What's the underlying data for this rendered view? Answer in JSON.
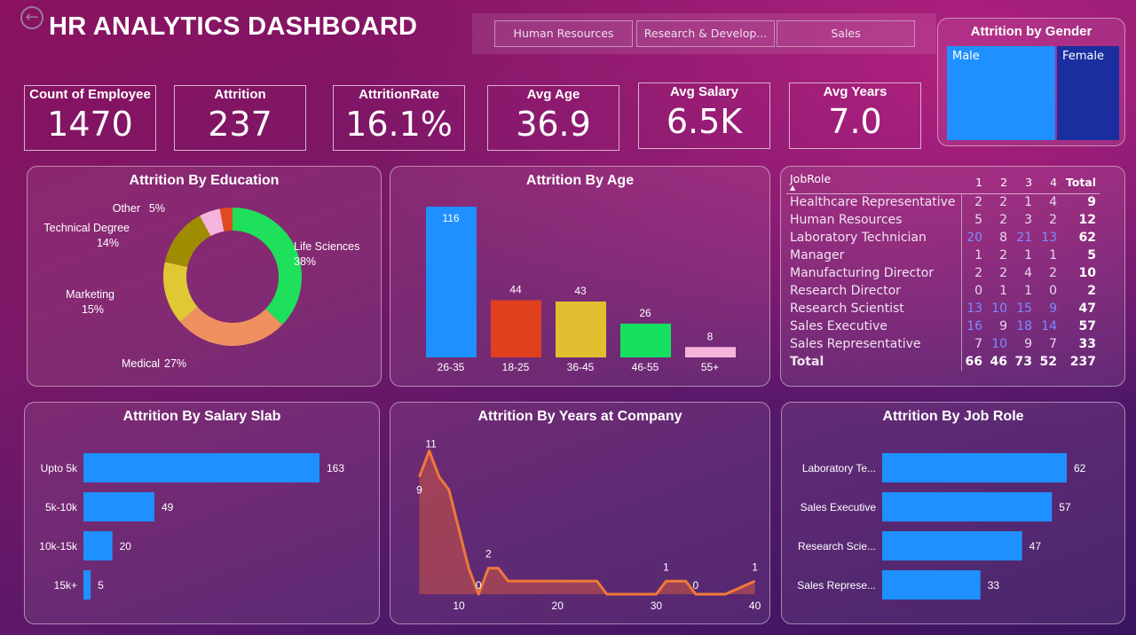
{
  "header": {
    "title": "HR ANALYTICS DASHBOARD",
    "back_icon": "arrow-left-circle-icon"
  },
  "filters": [
    "Human Resources",
    "Research & Develop...",
    "Sales"
  ],
  "gender": {
    "title": "Attrition by Gender",
    "male": "Male",
    "female": "Female",
    "colors": {
      "male": "#1e90ff",
      "female": "#1a2ea0"
    }
  },
  "kpis": [
    {
      "label": "Count of Employee",
      "value": "1470"
    },
    {
      "label": "Attrition",
      "value": "237"
    },
    {
      "label": "AttritionRate",
      "value": "16.1%"
    },
    {
      "label": "Avg Age",
      "value": "36.9"
    },
    {
      "label": "Avg Salary",
      "value": "6.5K"
    },
    {
      "label": "Avg Years",
      "value": "7.0"
    }
  ],
  "table": {
    "headers": [
      "JobRole",
      "1",
      "2",
      "3",
      "4",
      "Total"
    ],
    "rows": [
      [
        "Healthcare Representative",
        "2",
        "2",
        "1",
        "4",
        "9"
      ],
      [
        "Human Resources",
        "5",
        "2",
        "3",
        "2",
        "12"
      ],
      [
        "Laboratory Technician",
        "20",
        "8",
        "21",
        "13",
        "62"
      ],
      [
        "Manager",
        "1",
        "2",
        "1",
        "1",
        "5"
      ],
      [
        "Manufacturing Director",
        "2",
        "2",
        "4",
        "2",
        "10"
      ],
      [
        "Research Director",
        "0",
        "1",
        "1",
        "0",
        "2"
      ],
      [
        "Research Scientist",
        "13",
        "10",
        "15",
        "9",
        "47"
      ],
      [
        "Sales Executive",
        "16",
        "9",
        "18",
        "14",
        "57"
      ],
      [
        "Sales Representative",
        "7",
        "10",
        "9",
        "7",
        "33"
      ]
    ],
    "total": [
      "Total",
      "66",
      "46",
      "73",
      "52",
      "237"
    ]
  },
  "chart_data": [
    {
      "type": "pie",
      "title": "Attrition By Education",
      "donut": true,
      "slices": [
        {
          "name": "Life Sciences",
          "value": 38,
          "label": "38%",
          "color": "#1ee05a"
        },
        {
          "name": "Medical",
          "value": 27,
          "label": "27%",
          "color": "#f09060"
        },
        {
          "name": "Marketing",
          "value": 15,
          "label": "15%",
          "color": "#e0c834"
        },
        {
          "name": "Technical Degree",
          "value": 14,
          "label": "14%",
          "color": "#a08c00"
        },
        {
          "name": "Other",
          "value": 5,
          "label": "5%",
          "color": "#f5b4dc"
        },
        {
          "name": "",
          "value": 3,
          "label": "",
          "color": "#e04a1e"
        }
      ]
    },
    {
      "type": "bar",
      "title": "Attrition By Age",
      "categories": [
        "26-35",
        "18-25",
        "36-45",
        "46-55",
        "55+"
      ],
      "values": [
        116,
        44,
        43,
        26,
        8
      ],
      "colors": [
        "#1e90ff",
        "#e0401e",
        "#e0c030",
        "#16e060",
        "#f5b4dc"
      ]
    },
    {
      "type": "bar",
      "orientation": "horizontal",
      "title": "Attrition By Salary Slab",
      "categories": [
        "Upto 5k",
        "5k-10k",
        "10k-15k",
        "15k+"
      ],
      "values": [
        163,
        49,
        20,
        5
      ],
      "color": "#1e90ff"
    },
    {
      "type": "area",
      "title": "Attrition By Years at Company",
      "x": [
        6,
        7,
        8,
        9,
        10,
        11,
        12,
        13,
        14,
        15,
        16,
        17,
        18,
        19,
        20,
        21,
        22,
        23,
        24,
        25,
        26,
        27,
        28,
        29,
        30,
        31,
        32,
        33,
        34,
        35,
        36,
        37,
        38,
        39,
        40
      ],
      "y": [
        9,
        11,
        9,
        8,
        5,
        2,
        0,
        2,
        2,
        1,
        1,
        1,
        1,
        1,
        1,
        1,
        1,
        1,
        1,
        0,
        0,
        0,
        0,
        0,
        0,
        1,
        1,
        1,
        0,
        0,
        0,
        0,
        0.33,
        0.67,
        1
      ],
      "data_labels": [
        {
          "x": 6,
          "text": "9"
        },
        {
          "x": 7,
          "text": "11"
        },
        {
          "x": 12,
          "text": "0"
        },
        {
          "x": 13,
          "text": "2"
        },
        {
          "x": 31,
          "text": "1"
        },
        {
          "x": 34,
          "text": "0"
        },
        {
          "x": 40,
          "text": "1"
        }
      ],
      "xticks": [
        10,
        20,
        30,
        40
      ],
      "color": "#f07838"
    },
    {
      "type": "bar",
      "orientation": "horizontal",
      "title": "Attrition By Job Role",
      "categories": [
        "Laboratory Te...",
        "Sales Executive",
        "Research Scie...",
        "Sales Represe..."
      ],
      "values": [
        62,
        57,
        47,
        33
      ],
      "color": "#1e90ff"
    }
  ]
}
